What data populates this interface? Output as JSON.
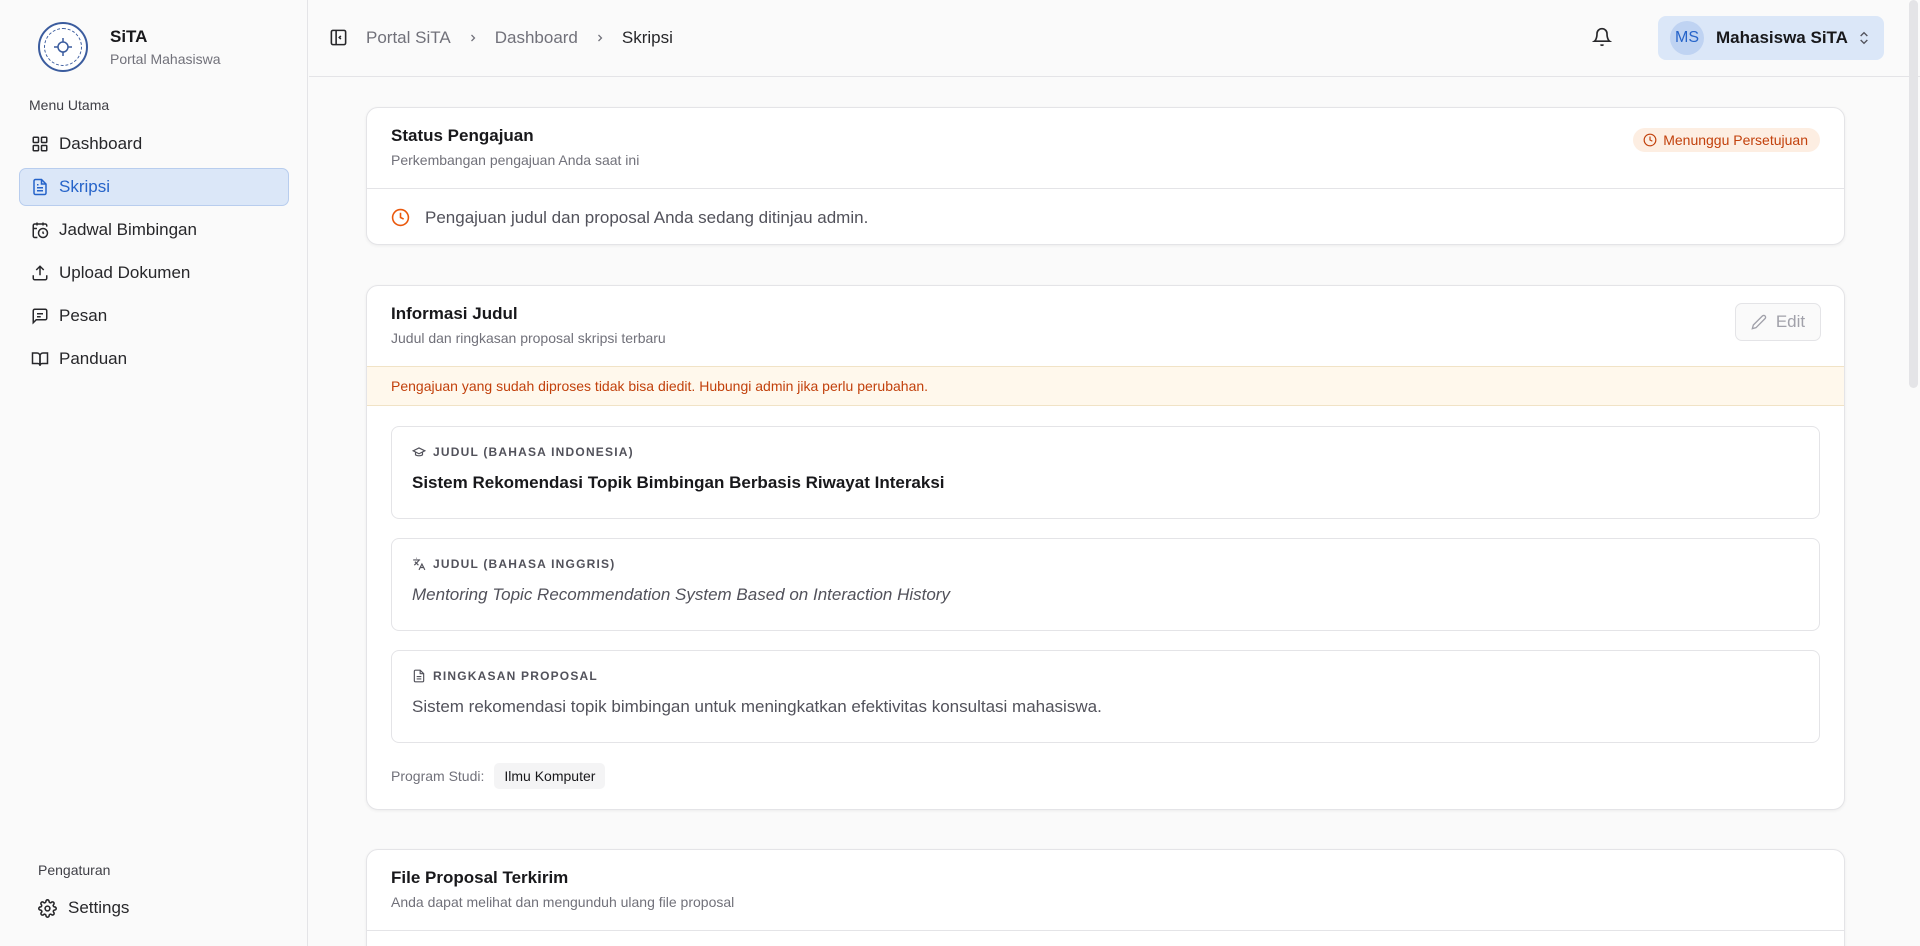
{
  "sidebar": {
    "brand_title": "SiTA",
    "brand_subtitle": "Portal Mahasiswa",
    "menu_label": "Menu Utama",
    "items": [
      {
        "label": "Dashboard",
        "icon": "grid-icon"
      },
      {
        "label": "Skripsi",
        "icon": "document-icon",
        "active": true
      },
      {
        "label": "Jadwal Bimbingan",
        "icon": "calendar-clock-icon"
      },
      {
        "label": "Upload Dokumen",
        "icon": "upload-icon"
      },
      {
        "label": "Pesan",
        "icon": "message-icon"
      },
      {
        "label": "Panduan",
        "icon": "book-icon"
      }
    ],
    "settings_label": "Pengaturan",
    "settings_item": "Settings"
  },
  "header": {
    "breadcrumb": [
      "Portal SiTA",
      "Dashboard",
      "Skripsi"
    ],
    "user_initials": "MS",
    "user_name": "Mahasiswa SiTA"
  },
  "status_card": {
    "title": "Status Pengajuan",
    "subtitle": "Perkembangan pengajuan Anda saat ini",
    "badge": "Menunggu Persetujuan",
    "message": "Pengajuan judul dan proposal Anda sedang ditinjau admin."
  },
  "info_card": {
    "title": "Informasi Judul",
    "subtitle": "Judul dan ringkasan proposal skripsi terbaru",
    "edit_label": "Edit",
    "warning": "Pengajuan yang sudah diproses tidak bisa diedit. Hubungi admin jika perlu perubahan.",
    "fields": [
      {
        "label": "JUDUL (BAHASA INDONESIA)",
        "value": "Sistem Rekomendasi Topik Bimbingan Berbasis Riwayat Interaksi"
      },
      {
        "label": "JUDUL (BAHASA INGGRIS)",
        "value": "Mentoring Topic Recommendation System Based on Interaction History"
      },
      {
        "label": "RINGKASAN PROPOSAL",
        "value": "Sistem rekomendasi topik bimbingan untuk meningkatkan efektivitas konsultasi mahasiswa."
      }
    ],
    "program_label": "Program Studi:",
    "program_value": "Ilmu Komputer"
  },
  "file_card": {
    "title": "File Proposal Terkirim",
    "subtitle": "Anda dapat melihat dan mengunduh ulang file proposal"
  },
  "colors": {
    "accent": "#2563c9",
    "active_bg": "#dbe7f8",
    "warning": "#c2410c"
  }
}
